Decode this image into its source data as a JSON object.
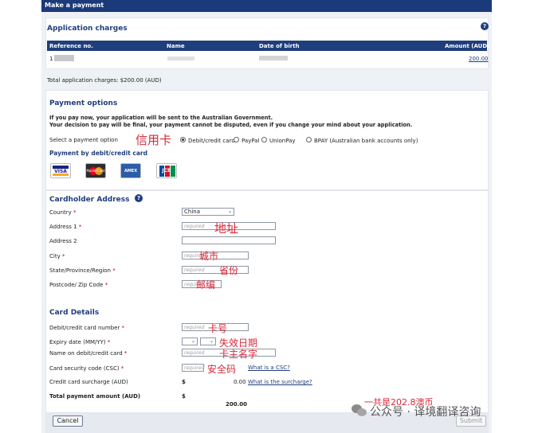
{
  "header": {
    "title": "Make a payment"
  },
  "charges": {
    "title": "Application charges",
    "columns": {
      "reference": "Reference no.",
      "name": "Name",
      "dob": "Date of birth",
      "amount": "Amount (AUD)"
    },
    "row": {
      "reference": "1",
      "amount": "200.00"
    },
    "total_label": "Total application charges: $200.00 (AUD)"
  },
  "payment_options": {
    "title": "Payment options",
    "notice_line1": "If you pay now, your application will be sent to the Australian Government.",
    "notice_line2": "Your decision to pay will be final, your payment cannot be disputed, even if you change your mind about your application.",
    "select_label": "Select a payment option",
    "options": {
      "card": "Debit/credit card",
      "paypal": "PayPal",
      "unionpay": "UnionPay",
      "bpay": "BPAY (Australian bank accounts only)"
    },
    "selected": "card",
    "by_card_label": "Payment by debit/credit card",
    "cards": [
      "VISA",
      "MasterCard",
      "AMEX",
      "JCB"
    ]
  },
  "cardholder": {
    "title": "Cardholder Address",
    "country_label": "Country",
    "country_value": "China",
    "address1_label": "Address 1",
    "address2_label": "Address 2",
    "city_label": "City",
    "state_label": "State/Province/Region",
    "postcode_label": "Postcode/ Zip Code",
    "placeholder": "required"
  },
  "card_details": {
    "title": "Card Details",
    "number_label": "Debit/credit card number",
    "expiry_label": "Expiry date (MM/YY)",
    "name_label": "Name on debit/credit card",
    "csc_label": "Card security code (CSC)",
    "csc_link": "What is a CSC?",
    "surcharge_label": "Credit card surcharge (AUD)",
    "surcharge_currency": "$",
    "surcharge_value": "0.00",
    "surcharge_link": "What is the surcharge?",
    "total_label": "Total payment amount (AUD)",
    "total_currency": "$",
    "total_value": "200.00"
  },
  "annotations": {
    "card": "信用卡",
    "address": "地址",
    "city": "城市",
    "state": "省份",
    "postcode": "邮编",
    "number": "卡号",
    "expiry": "失效日期",
    "name": "卡主名字",
    "csc": "安全码",
    "total_note": "一共是202.8澳币"
  },
  "footer": {
    "cancel": "Cancel",
    "submit": "Submit"
  },
  "watermark": "公众号 · 译境翻译咨询",
  "colors": {
    "primary": "#1f3e7c",
    "annotation": "#d6293a"
  }
}
